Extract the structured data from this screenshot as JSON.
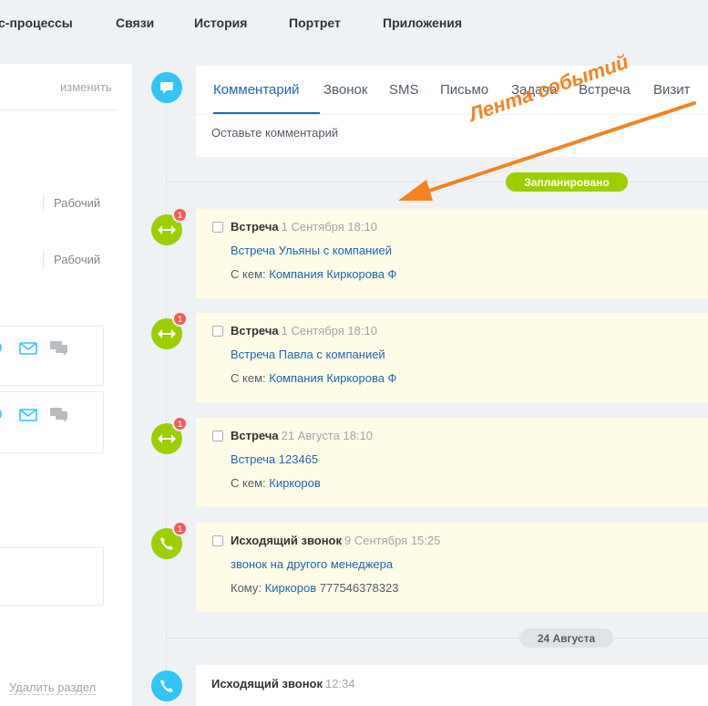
{
  "nav": {
    "items": [
      "с-процессы",
      "Связи",
      "История",
      "Портрет",
      "Приложения"
    ]
  },
  "left": {
    "change_link": "изменить",
    "work_label_1": "Рабочий",
    "work_label_2": "Рабочий",
    "delete_section": "Удалить раздел"
  },
  "composer": {
    "tabs": [
      "Комментарий",
      "Звонок",
      "SMS",
      "Письмо",
      "Задача",
      "Встреча",
      "Визит"
    ],
    "placeholder": "Оставьте комментарий"
  },
  "annotation": {
    "text": "Лента событий",
    "color": "#f5821f"
  },
  "sections": {
    "planned": "Запланировано",
    "date_divider": "24 Августа"
  },
  "events": [
    {
      "icon": "meeting-icon",
      "badge": "1",
      "type": "Встреча",
      "date": "1 Сентября 18:10",
      "subject": "Встреча Ульяны с компанией",
      "with_label": "С кем:",
      "with_value": "Компания Киркорова Ф",
      "with_suffix": ""
    },
    {
      "icon": "meeting-icon",
      "badge": "1",
      "type": "Встреча",
      "date": "1 Сентября 18:10",
      "subject": "Встреча Павла с компанией",
      "with_label": "С кем:",
      "with_value": "Компания Киркорова Ф",
      "with_suffix": ""
    },
    {
      "icon": "meeting-icon",
      "badge": "1",
      "type": "Встреча",
      "date": "21 Августа 18:10",
      "subject": "Встреча 123465",
      "with_label": "С кем:",
      "with_value": "Киркоров",
      "with_suffix": ""
    },
    {
      "icon": "phone-icon",
      "badge": "1",
      "type": "Исходящий звонок",
      "date": "9 Сентября 15:25",
      "subject": "звонок на другого менеджера",
      "with_label": "Кому:",
      "with_value": "Киркоров",
      "with_suffix": "777546378323"
    }
  ],
  "history": [
    {
      "icon": "phone-icon",
      "type": "Исходящий звонок",
      "time": "12:34"
    }
  ],
  "colors": {
    "accent": "#2067b0",
    "green": "#9dcf00",
    "blue": "#2fc6f6",
    "badge": "#ff5752",
    "planned_card": "#fefce7"
  }
}
